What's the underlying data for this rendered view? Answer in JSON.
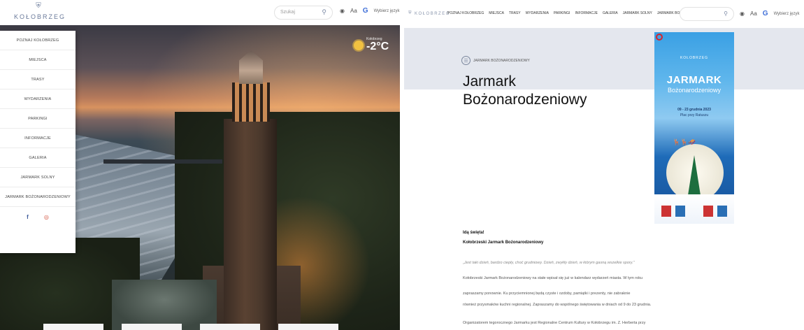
{
  "left": {
    "logo": {
      "emblem": "⛨",
      "name": "KOŁOBRZEG"
    },
    "search": {
      "placeholder": "Szukaj"
    },
    "tools": {
      "eye_icon": "eye-icon",
      "font_size": "Aa",
      "translate_label": "Wybierz język"
    },
    "weather": {
      "city": "Kołobrzeg",
      "temperature": "-2°C"
    },
    "menu": [
      "Poznaj Kołobrzeg",
      "Miejsca",
      "Trasy",
      "Wydarzenia",
      "Parkingi",
      "Informacje",
      "Galeria",
      "Jarmark Solny",
      "Jarmark Bożonarodzeniowy"
    ],
    "social": {
      "facebook": "f",
      "instagram": "◎"
    }
  },
  "right": {
    "logo": "KOŁOBRZEG",
    "nav": [
      "Poznaj Kołobrzeg",
      "Miejsca",
      "Trasy",
      "Wydarzenia",
      "Parkingi",
      "Informacje",
      "Galeria",
      "Jarmark Solny",
      "Jarmark Bożonarodzeniowy"
    ],
    "tools": {
      "font_size": "Aa",
      "translate_label": "Wybierz język"
    },
    "breadcrumb": "Jarmark Bożonarodzeniowy",
    "title": "Jarmark Bożonarodzeniowy",
    "poster": {
      "logo": "KOŁOBRZEG",
      "title": "JARMARK",
      "subtitle": "Bożonarodzeniowy",
      "date": "09 - 23 grudnia 2023",
      "place": "Plac przy Ratuszu"
    },
    "content": {
      "heading1": "Idą święta!",
      "heading2": "Kołobrzeski Jarmark Bożonarodzeniowy",
      "quote": "„Jest taki dzień, bardzo ciepły, choć grudniowy. Dzień, zwykły dzień, w którym gasną wszelkie spory.”",
      "p1": "Kołobrzeski Jarmark Bożonarodzeniowy na stałe wpisał się już w kalendarz wydarzeń miasta. W tym roku",
      "p2": "zapraszamy ponownie. Ku przyciemnionej będą czyste i ozdoby, pamiątki i prezenty, nie zabraknie",
      "p3": "również przysmaków kuchni regionalnej. Zapraszamy do wspólnego świętowania w dniach od 9 do 23 grudnia.",
      "p4": "Organizatorem tegorocznego Jarmarku jest Regionalne Centrum Kultury w Kołobrzegu im. Z. Herberta przy"
    }
  }
}
